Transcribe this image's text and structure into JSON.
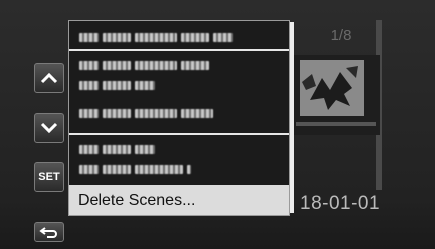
{
  "header": {
    "page_counter": "1/8"
  },
  "thumbnail": {
    "date": "18-01-01",
    "image": "leaves-thumbnail"
  },
  "side_buttons": [
    {
      "icon": "chevron-up-icon"
    },
    {
      "icon": "chevron-down-icon"
    },
    {
      "label": "SET"
    },
    {
      "icon": "return-icon"
    }
  ],
  "menu": {
    "selected_item": "Delete Scenes...",
    "blurred_items": 6
  },
  "colors": {
    "menu_bg": "#1b1b1b",
    "selection_bg": "#dcdcdc",
    "separator": "#e6e6e6"
  }
}
